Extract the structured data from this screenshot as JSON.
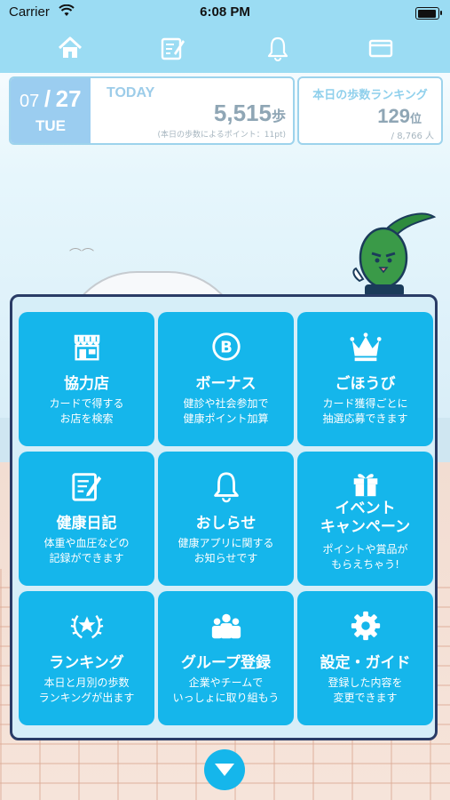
{
  "status_bar": {
    "carrier": "Carrier",
    "time": "6:08 PM"
  },
  "nav": {
    "tabs": [
      "home-icon",
      "notebook-icon",
      "bell-icon",
      "card-icon"
    ]
  },
  "today": {
    "month": "07",
    "separator": "/",
    "day": "27",
    "weekday": "TUE",
    "label": "TODAY",
    "steps": "5,515",
    "steps_unit": "歩",
    "points_note": "(本日の歩数によるポイント：11pt)"
  },
  "ranking": {
    "title": "本日の歩数ランキング",
    "rank": "129",
    "rank_unit": "位",
    "total": "/ 8,766 人"
  },
  "menu": [
    {
      "icon": "shop-icon",
      "title": "協力店",
      "desc": "カードで得する\nお店を検索"
    },
    {
      "icon": "bonus-icon",
      "title": "ボーナス",
      "desc": "健診や社会参加で\n健康ポイント加算"
    },
    {
      "icon": "crown-icon",
      "title": "ごほうび",
      "desc": "カード獲得ごとに\n抽選応募できます"
    },
    {
      "icon": "diary-icon",
      "title": "健康日記",
      "desc": "体重や血圧などの\n記録ができます"
    },
    {
      "icon": "bell-icon",
      "title": "おしらせ",
      "desc": "健康アプリに関する\nお知らせです"
    },
    {
      "icon": "gift-icon",
      "title": "イベント\nキャンペーン",
      "desc": "ポイントや賞品が\nもらえちゃう!"
    },
    {
      "icon": "laurel-star-icon",
      "title": "ランキング",
      "desc": "本日と月別の歩数\nランキングが出ます"
    },
    {
      "icon": "group-icon",
      "title": "グループ登録",
      "desc": "企業やチームで\nいっしょに取り組もう"
    },
    {
      "icon": "gear-icon",
      "title": "設定・ガイド",
      "desc": "登録した内容を\n変更できます"
    }
  ],
  "colors": {
    "header": "#9bdcf3",
    "tile": "#15b6eb",
    "panel_border": "#2a3c66"
  }
}
